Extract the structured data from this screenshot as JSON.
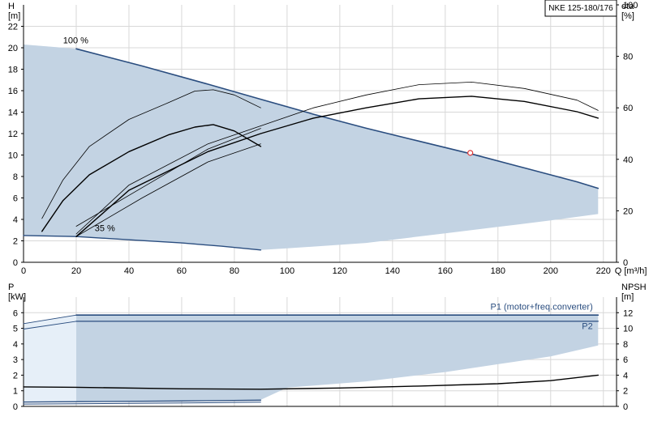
{
  "chart_data": [
    {
      "type": "line",
      "title": "NKE 125-180/176",
      "ylabel_left": [
        "H",
        "[m]"
      ],
      "ylabel_right": [
        "eta",
        "[%]"
      ],
      "xlabel": "Q [m³/h]",
      "xlim": [
        0,
        225
      ],
      "ylim": [
        0,
        24
      ],
      "ylim_right": [
        0,
        100
      ],
      "x_ticks": [
        0,
        20,
        40,
        60,
        80,
        100,
        120,
        140,
        160,
        180,
        200,
        220
      ],
      "y_ticks": [
        0,
        2,
        4,
        6,
        8,
        10,
        12,
        14,
        16,
        18,
        20,
        22
      ],
      "y_ticks_right": [
        0,
        20,
        40,
        60,
        80,
        100
      ],
      "grid": true,
      "annotations": [
        {
          "text": "100 %",
          "x": 15,
          "y": 20.4
        },
        {
          "text": "35 %",
          "x": 27,
          "y": 2.9
        }
      ],
      "operating_point": {
        "x": 169.5,
        "y": 10.2
      },
      "series": [
        {
          "role": "H-curve-100pct",
          "color": "#2a4d7f",
          "width": 1.6,
          "points": [
            [
              20,
              19.9
            ],
            [
              45,
              18.3
            ],
            [
              70,
              16.6
            ],
            [
              90,
              15.2
            ],
            [
              110,
              13.8
            ],
            [
              130,
              12.5
            ],
            [
              150,
              11.3
            ],
            [
              170,
              10.1
            ],
            [
              190,
              8.8
            ],
            [
              210,
              7.5
            ],
            [
              218,
              6.9
            ]
          ]
        },
        {
          "role": "H-curve-35pct",
          "color": "#2a4d7f",
          "width": 1.4,
          "points": [
            [
              0,
              2.5
            ],
            [
              20,
              2.4
            ],
            [
              40,
              2.1
            ],
            [
              60,
              1.8
            ],
            [
              75,
              1.5
            ],
            [
              90,
              1.15
            ]
          ]
        },
        {
          "role": "eta-curve-100pct",
          "color": "#000000",
          "width": 1.4,
          "axis": "right",
          "points": [
            [
              20,
              10
            ],
            [
              40,
              28
            ],
            [
              70,
              43
            ],
            [
              90,
              50
            ],
            [
              110,
              56
            ],
            [
              130,
              60
            ],
            [
              150,
              63.5
            ],
            [
              170,
              64.5
            ],
            [
              190,
              62.5
            ],
            [
              210,
              58.5
            ],
            [
              218,
              56
            ]
          ]
        },
        {
          "role": "eta-curve-100pct-b",
          "color": "#000000",
          "width": 0.8,
          "axis": "right",
          "points": [
            [
              20,
              11
            ],
            [
              40,
              30
            ],
            [
              70,
              46
            ],
            [
              90,
              53
            ],
            [
              110,
              60
            ],
            [
              130,
              65
            ],
            [
              150,
              69
            ],
            [
              170,
              70
            ],
            [
              190,
              67.5
            ],
            [
              210,
              63
            ],
            [
              218,
              59
            ]
          ]
        },
        {
          "role": "eta-curve-35pct",
          "color": "#000000",
          "width": 1.4,
          "axis": "right",
          "points": [
            [
              7,
              12
            ],
            [
              15,
              24
            ],
            [
              25,
              34
            ],
            [
              40,
              43
            ],
            [
              55,
              49.5
            ],
            [
              65,
              52.5
            ],
            [
              72,
              53.5
            ],
            [
              80,
              51
            ],
            [
              90,
              45
            ]
          ]
        },
        {
          "role": "eta-curve-35pct-b",
          "color": "#000000",
          "width": 0.8,
          "axis": "right",
          "points": [
            [
              7,
              17
            ],
            [
              15,
              32
            ],
            [
              25,
              45
            ],
            [
              40,
              55.5
            ],
            [
              55,
              62
            ],
            [
              65,
              66.5
            ],
            [
              72,
              67
            ],
            [
              80,
              65
            ],
            [
              90,
              60
            ]
          ]
        },
        {
          "role": "eta-lower-a",
          "color": "#000000",
          "width": 0.8,
          "axis": "right",
          "points": [
            [
              20,
              14
            ],
            [
              45,
              29
            ],
            [
              70,
              44
            ],
            [
              90,
              52
            ]
          ]
        },
        {
          "role": "eta-lower-b",
          "color": "#000000",
          "width": 0.8,
          "axis": "right",
          "points": [
            [
              20,
              10
            ],
            [
              45,
              25
            ],
            [
              70,
              39
            ],
            [
              90,
              46
            ]
          ]
        }
      ],
      "operating_region": {
        "upper": [
          [
            0,
            20.3
          ],
          [
            20,
            19.9
          ],
          [
            45,
            18.3
          ],
          [
            70,
            16.6
          ],
          [
            90,
            15.2
          ],
          [
            110,
            13.8
          ],
          [
            130,
            12.5
          ],
          [
            150,
            11.3
          ],
          [
            170,
            10.1
          ],
          [
            190,
            8.8
          ],
          [
            210,
            7.5
          ],
          [
            218,
            6.9
          ]
        ],
        "lower": [
          [
            218,
            4.5
          ],
          [
            200,
            3.9
          ],
          [
            180,
            3.3
          ],
          [
            160,
            2.7
          ],
          [
            130,
            1.8
          ],
          [
            100,
            1.3
          ],
          [
            90,
            1.15
          ],
          [
            60,
            1.8
          ],
          [
            20,
            2.4
          ],
          [
            0,
            2.5
          ]
        ]
      },
      "extension_region": {
        "points": [
          [
            0,
            20.3
          ],
          [
            20,
            19.9
          ],
          [
            20,
            2.4
          ],
          [
            0,
            2.5
          ]
        ]
      }
    },
    {
      "type": "line",
      "ylabel_left": [
        "P",
        "[kW]"
      ],
      "ylabel_right": [
        "NPSH",
        "[m]"
      ],
      "xlim": [
        0,
        225
      ],
      "ylim": [
        0,
        7
      ],
      "ylim_right": [
        0,
        14
      ],
      "y_ticks": [
        0,
        1,
        2,
        3,
        4,
        5,
        6
      ],
      "y_ticks_right": [
        0,
        2,
        4,
        6,
        8,
        10,
        12
      ],
      "grid": true,
      "annotations": [
        {
          "text": "P1 (motor+freq.converter)",
          "x": 216,
          "y": 6.2,
          "anchor": "end"
        },
        {
          "text": "P2",
          "x": 216,
          "y": 4.95,
          "anchor": "end"
        }
      ],
      "series": [
        {
          "role": "P1-line",
          "color": "#2a4d7f",
          "width": 1.6,
          "points": [
            [
              20,
              5.85
            ],
            [
              218,
              5.85
            ]
          ]
        },
        {
          "role": "P1-extension",
          "color": "#2a4d7f",
          "width": 0.9,
          "points": [
            [
              0,
              5.3
            ],
            [
              20,
              5.85
            ]
          ]
        },
        {
          "role": "P2-line",
          "color": "#2a4d7f",
          "width": 1.3,
          "points": [
            [
              20,
              5.45
            ],
            [
              218,
              5.45
            ]
          ]
        },
        {
          "role": "P2-extension",
          "color": "#2a4d7f",
          "width": 0.9,
          "points": [
            [
              0,
              4.95
            ],
            [
              20,
              5.45
            ]
          ]
        },
        {
          "role": "NPSH-curve",
          "color": "#000000",
          "width": 1.4,
          "axis": "right",
          "points": [
            [
              0,
              2.5
            ],
            [
              20,
              2.45
            ],
            [
              60,
              2.25
            ],
            [
              90,
              2.2
            ],
            [
              120,
              2.35
            ],
            [
              150,
              2.6
            ],
            [
              180,
              2.9
            ],
            [
              200,
              3.3
            ],
            [
              218,
              4.0
            ]
          ]
        },
        {
          "role": "P1-35pct",
          "color": "#2a4d7f",
          "width": 1.3,
          "points": [
            [
              0,
              0.28
            ],
            [
              20,
              0.3
            ],
            [
              60,
              0.35
            ],
            [
              90,
              0.4
            ]
          ]
        },
        {
          "role": "P2-35pct",
          "color": "#2a4d7f",
          "width": 1.0,
          "points": [
            [
              0,
              0.15
            ],
            [
              20,
              0.17
            ],
            [
              60,
              0.22
            ],
            [
              90,
              0.27
            ]
          ]
        }
      ],
      "operating_region": {
        "upper": [
          [
            20,
            5.85
          ],
          [
            218,
            5.85
          ]
        ],
        "lower": [
          [
            218,
            3.9
          ],
          [
            200,
            3.2
          ],
          [
            180,
            2.7
          ],
          [
            160,
            2.2
          ],
          [
            130,
            1.6
          ],
          [
            100,
            1.2
          ],
          [
            90,
            0.42
          ],
          [
            20,
            0.3
          ]
        ]
      },
      "extension_region": {
        "points": [
          [
            0,
            5.3
          ],
          [
            20,
            5.85
          ],
          [
            20,
            0.3
          ],
          [
            0,
            0.28
          ]
        ]
      }
    }
  ],
  "colors": {
    "region_fill": "#c3d3e3",
    "extension_fill": "#e6eff8",
    "grid": "#d8d8d8",
    "axis": "#000000",
    "text": "#000000",
    "label_blue": "#2a4d7f",
    "operating_point": "#e03b3b"
  }
}
